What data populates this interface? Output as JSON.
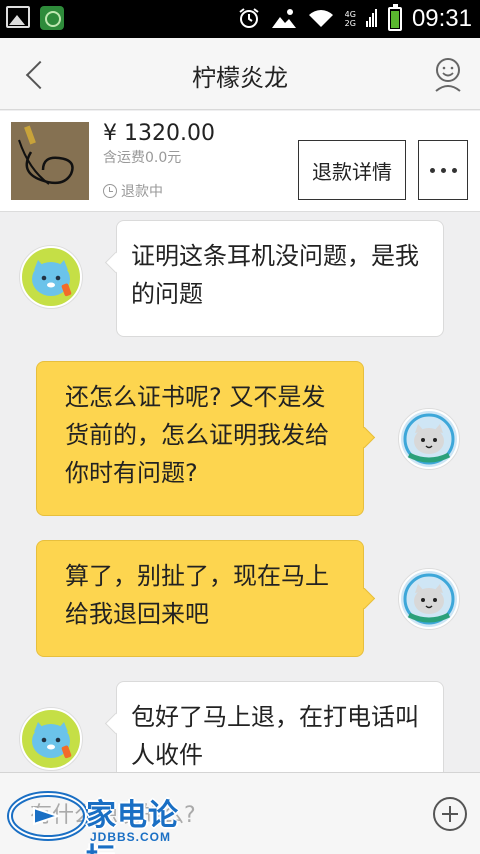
{
  "status_bar": {
    "time": "09:31",
    "network_top": "4G",
    "network_bottom": "2G",
    "battery_level": 0.85
  },
  "header": {
    "title": "柠檬炎龙",
    "back_icon": "chevron-left-icon",
    "profile_icon": "smiley-face-icon"
  },
  "product": {
    "price": "¥ 1320.00",
    "shipping": "含运费0.0元",
    "status": "退款中",
    "refund_button": "退款详情",
    "more_icon": "more-dots-icon"
  },
  "messages": [
    {
      "side": "left",
      "text": "证明这条耳机没问题，是我的问题"
    },
    {
      "side": "right",
      "text": "还怎么证书呢? 又不是发货前的，怎么证明我发给你时有问题?"
    },
    {
      "side": "right",
      "text": "算了，别扯了，现在马上给我退回来吧"
    },
    {
      "side": "left",
      "text": "包好了马上退，在打电话叫人收件"
    }
  ],
  "input": {
    "placeholder": "有什么想说的么?",
    "add_icon": "plus-circle-icon"
  },
  "watermark": {
    "name": "家电论坛",
    "url": "JDBBS.COM"
  },
  "colors": {
    "bubble_right": "#fdd54f",
    "avatar_left": "#c5df46",
    "watermark_blue": "#1a6fc4"
  }
}
